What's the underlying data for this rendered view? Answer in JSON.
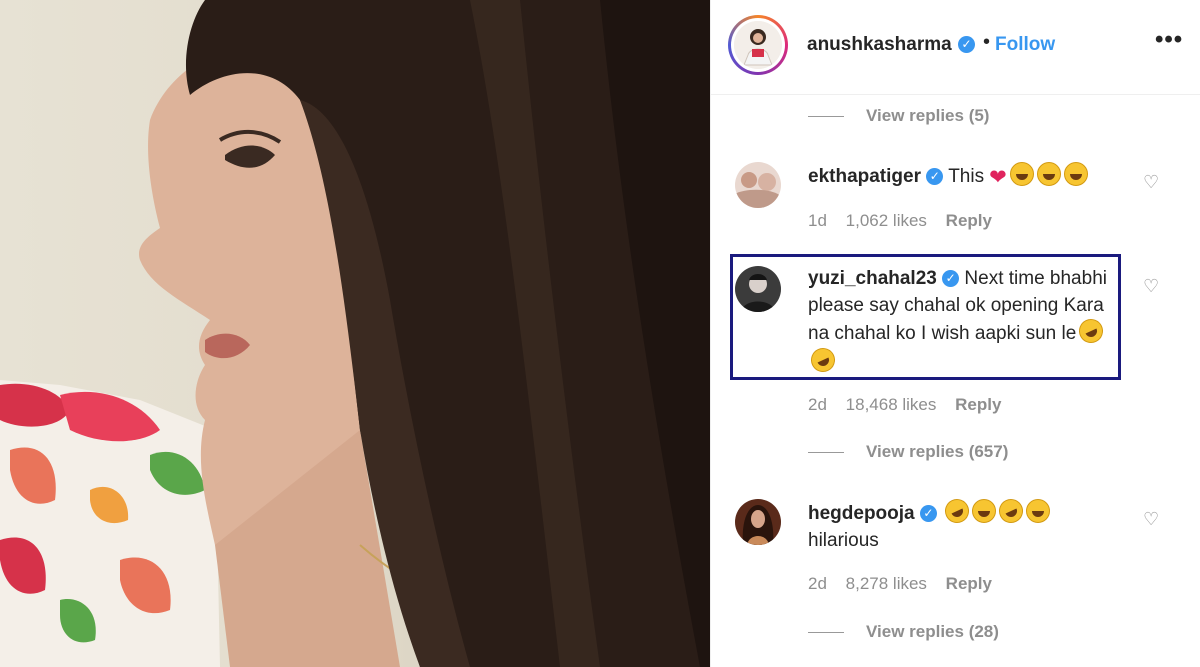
{
  "post": {
    "owner": "anushkasharma",
    "verified_icon": "verified-badge-icon",
    "follow_label": "Follow",
    "more_icon": "more-options-icon",
    "more_label": "•••"
  },
  "comments": [
    {
      "type": "view_replies",
      "label": "View replies (5)"
    },
    {
      "type": "comment",
      "username": "ekthapatiger",
      "text": "This",
      "emojis": [
        "red-heart",
        "laughing",
        "laughing",
        "laughing"
      ],
      "age": "1d",
      "likes": "1,062 likes",
      "reply_label": "Reply"
    },
    {
      "type": "comment",
      "username": "yuzi_chahal23",
      "text": "Next time bhabhi please say chahal ok opening Kara na chahal ko I wish aapki sun le",
      "emojis": [
        "rofl",
        "rofl"
      ],
      "age": "2d",
      "likes": "18,468 likes",
      "reply_label": "Reply",
      "highlighted": true
    },
    {
      "type": "view_replies",
      "label": "View replies (657)"
    },
    {
      "type": "comment",
      "username": "hegdepooja",
      "text": "hilarious",
      "emojis": [
        "rofl",
        "laughing",
        "rofl",
        "laughing"
      ],
      "age": "2d",
      "likes": "8,278 likes",
      "reply_label": "Reply"
    },
    {
      "type": "view_replies",
      "label": "View replies (28)"
    }
  ],
  "colors": {
    "link_blue": "#3897f0",
    "text_dark": "#262626",
    "text_grey": "#8e8e8e",
    "highlight_border": "#1a1a7e"
  }
}
